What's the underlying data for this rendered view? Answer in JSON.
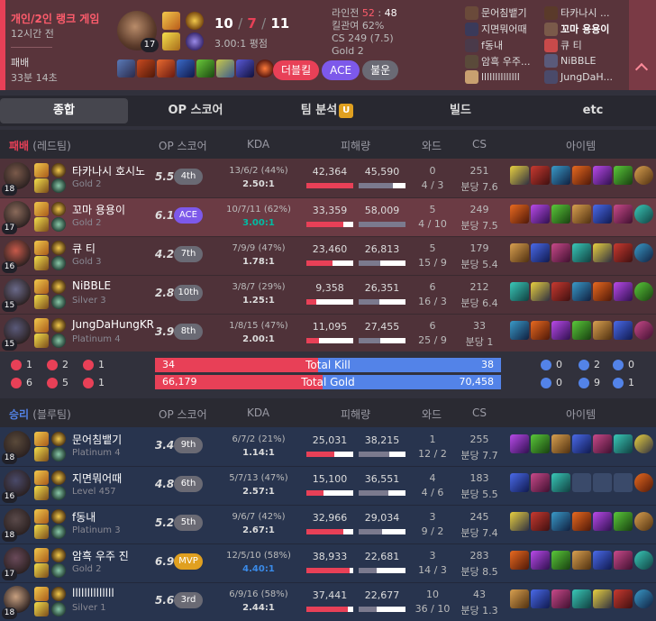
{
  "header": {
    "queue_type": "개인/2인 랭크 게임",
    "time_ago": "12시간 전",
    "result": "패배",
    "duration": "33분 14초",
    "champion_level": "17",
    "kills": "10",
    "deaths": "7",
    "assists": "11",
    "kda_ratio": "3.00:1 평점",
    "lane_label": "라인전",
    "lane_score_a": "52",
    "lane_score_b": "48",
    "kill_participation": "킬관여 62%",
    "cs": "CS 249 (7.5)",
    "rank": "Gold 2",
    "tags": [
      {
        "label": "더블킬",
        "color": "#e84057"
      },
      {
        "label": "ACE",
        "color": "#7d59ea"
      },
      {
        "label": "불운",
        "color": "#6a6a74"
      }
    ],
    "players_left": [
      "문어침뱉기",
      "지면뭐어때",
      "f동내",
      "암흑 우주...",
      "llllllllllllll"
    ],
    "players_right": [
      "타카나시 ...",
      "꼬마 용용이",
      "큐 티",
      "NiBBLE",
      "JungDaH..."
    ]
  },
  "tabs": {
    "overview": "종합",
    "op_score": "OP 스코어",
    "team_analysis": "팀 분석",
    "team_badge": "U",
    "build": "빌드",
    "etc": "etc"
  },
  "columns": {
    "op_score": "OP 스코어",
    "kda": "KDA",
    "damage": "피해량",
    "wards": "와드",
    "cs": "CS",
    "items": "아이템"
  },
  "red_team": {
    "result": "패배",
    "team_name": "(레드팀)",
    "players": [
      {
        "name": "타카나시 호시노",
        "tier": "Gold 2",
        "level": "18",
        "score": "5.5",
        "rank": "4th",
        "kda": "13/6/2 (44%)",
        "ratio": "2.50:1",
        "dmg_dealt": "42,364",
        "dmg_taken": "45,590",
        "dealt_frac": 1.0,
        "taken_frac": 0.74,
        "wards": "0",
        "wards2": "4 / 3",
        "cs": "251",
        "cs_min": "분당 7.6",
        "me": false
      },
      {
        "name": "꼬마 용용이",
        "tier": "Gold 2",
        "level": "17",
        "score": "6.1",
        "rank": "ACE",
        "kda": "10/7/11 (62%)",
        "ratio": "3.00:1",
        "dmg_dealt": "33,359",
        "dmg_taken": "58,009",
        "dealt_frac": 0.79,
        "taken_frac": 1.0,
        "wards": "5",
        "wards2": "4 / 10",
        "cs": "249",
        "cs_min": "분당 7.5",
        "me": true
      },
      {
        "name": "큐 티",
        "tier": "Gold 3",
        "level": "16",
        "score": "4.2",
        "rank": "7th",
        "kda": "7/9/9 (47%)",
        "ratio": "1.78:1",
        "dmg_dealt": "23,460",
        "dmg_taken": "26,813",
        "dealt_frac": 0.55,
        "taken_frac": 0.46,
        "wards": "5",
        "wards2": "15 / 9",
        "cs": "179",
        "cs_min": "분당 5.4",
        "me": false
      },
      {
        "name": "NiBBLE",
        "tier": "Silver 3",
        "level": "15",
        "score": "2.8",
        "rank": "10th",
        "kda": "3/8/7 (29%)",
        "ratio": "1.25:1",
        "dmg_dealt": "9,358",
        "dmg_taken": "26,351",
        "dealt_frac": 0.22,
        "taken_frac": 0.45,
        "wards": "6",
        "wards2": "16 / 3",
        "cs": "212",
        "cs_min": "분당 6.4",
        "me": false
      },
      {
        "name": "JungDaHungKR",
        "tier": "Platinum 4",
        "level": "15",
        "score": "3.9",
        "rank": "8th",
        "kda": "1/8/15 (47%)",
        "ratio": "2.00:1",
        "dmg_dealt": "11,095",
        "dmg_taken": "27,455",
        "dealt_frac": 0.26,
        "taken_frac": 0.47,
        "wards": "6",
        "wards2": "25 / 9",
        "cs": "33",
        "cs_min": "분당 1",
        "me": false
      }
    ]
  },
  "summary": {
    "red_towers": "1",
    "red_dragons": "2",
    "red_barons": "1",
    "red_heralds": "6",
    "red_inhib": "5",
    "red_other": "1",
    "blue_towers": "0",
    "blue_dragons": "2",
    "blue_barons": "0",
    "blue_heralds": "0",
    "blue_inhib": "9",
    "blue_other": "1",
    "kill_label": "Total Kill",
    "red_kills": "34",
    "blue_kills": "38",
    "red_kill_frac": 0.472,
    "gold_label": "Total Gold",
    "red_gold": "66,179",
    "blue_gold": "70,458",
    "red_gold_frac": 0.484
  },
  "blue_team": {
    "result": "승리",
    "team_name": "(블루팀)",
    "players": [
      {
        "name": "문어침뱉기",
        "tier": "Platinum 4",
        "level": "18",
        "score": "3.4",
        "rank": "9th",
        "kda": "6/7/2 (21%)",
        "ratio": "1.14:1",
        "dmg_dealt": "25,031",
        "dmg_taken": "38,215",
        "dealt_frac": 0.59,
        "taken_frac": 0.66,
        "wards": "1",
        "wards2": "12 / 2",
        "cs": "255",
        "cs_min": "분당 7.7"
      },
      {
        "name": "지면뭐어때",
        "tier": "Level 457",
        "level": "16",
        "score": "4.8",
        "rank": "6th",
        "kda": "5/7/13 (47%)",
        "ratio": "2.57:1",
        "dmg_dealt": "15,100",
        "dmg_taken": "36,551",
        "dealt_frac": 0.36,
        "taken_frac": 0.63,
        "wards": "4",
        "wards2": "4 / 6",
        "cs": "183",
        "cs_min": "분당 5.5"
      },
      {
        "name": "f동내",
        "tier": "Platinum 3",
        "level": "18",
        "score": "5.2",
        "rank": "5th",
        "kda": "9/6/7 (42%)",
        "ratio": "2.67:1",
        "dmg_dealt": "32,966",
        "dmg_taken": "29,034",
        "dealt_frac": 0.78,
        "taken_frac": 0.5,
        "wards": "3",
        "wards2": "9 / 2",
        "cs": "245",
        "cs_min": "분당 7.4"
      },
      {
        "name": "암흑 우주 진",
        "tier": "Gold 2",
        "level": "17",
        "score": "6.9",
        "rank": "MVP",
        "kda": "12/5/10 (58%)",
        "ratio": "4.40:1",
        "dmg_dealt": "38,933",
        "dmg_taken": "22,681",
        "dealt_frac": 0.92,
        "taken_frac": 0.39,
        "wards": "3",
        "wards2": "14 / 3",
        "cs": "283",
        "cs_min": "분당 8.5"
      },
      {
        "name": "llllllllllllll",
        "tier": "Silver 1",
        "level": "18",
        "score": "5.6",
        "rank": "3rd",
        "kda": "6/9/16 (58%)",
        "ratio": "2.44:1",
        "dmg_dealt": "37,441",
        "dmg_taken": "22,677",
        "dealt_frac": 0.88,
        "taken_frac": 0.39,
        "wards": "10",
        "wards2": "36 / 10",
        "cs": "43",
        "cs_min": "분당 1.3"
      }
    ]
  },
  "colors": {
    "loss": "#e84057",
    "win": "#5383e8",
    "ace": "#7d59ea",
    "mvp": "#e0a020",
    "taken_bar": "#7b7a8e"
  }
}
